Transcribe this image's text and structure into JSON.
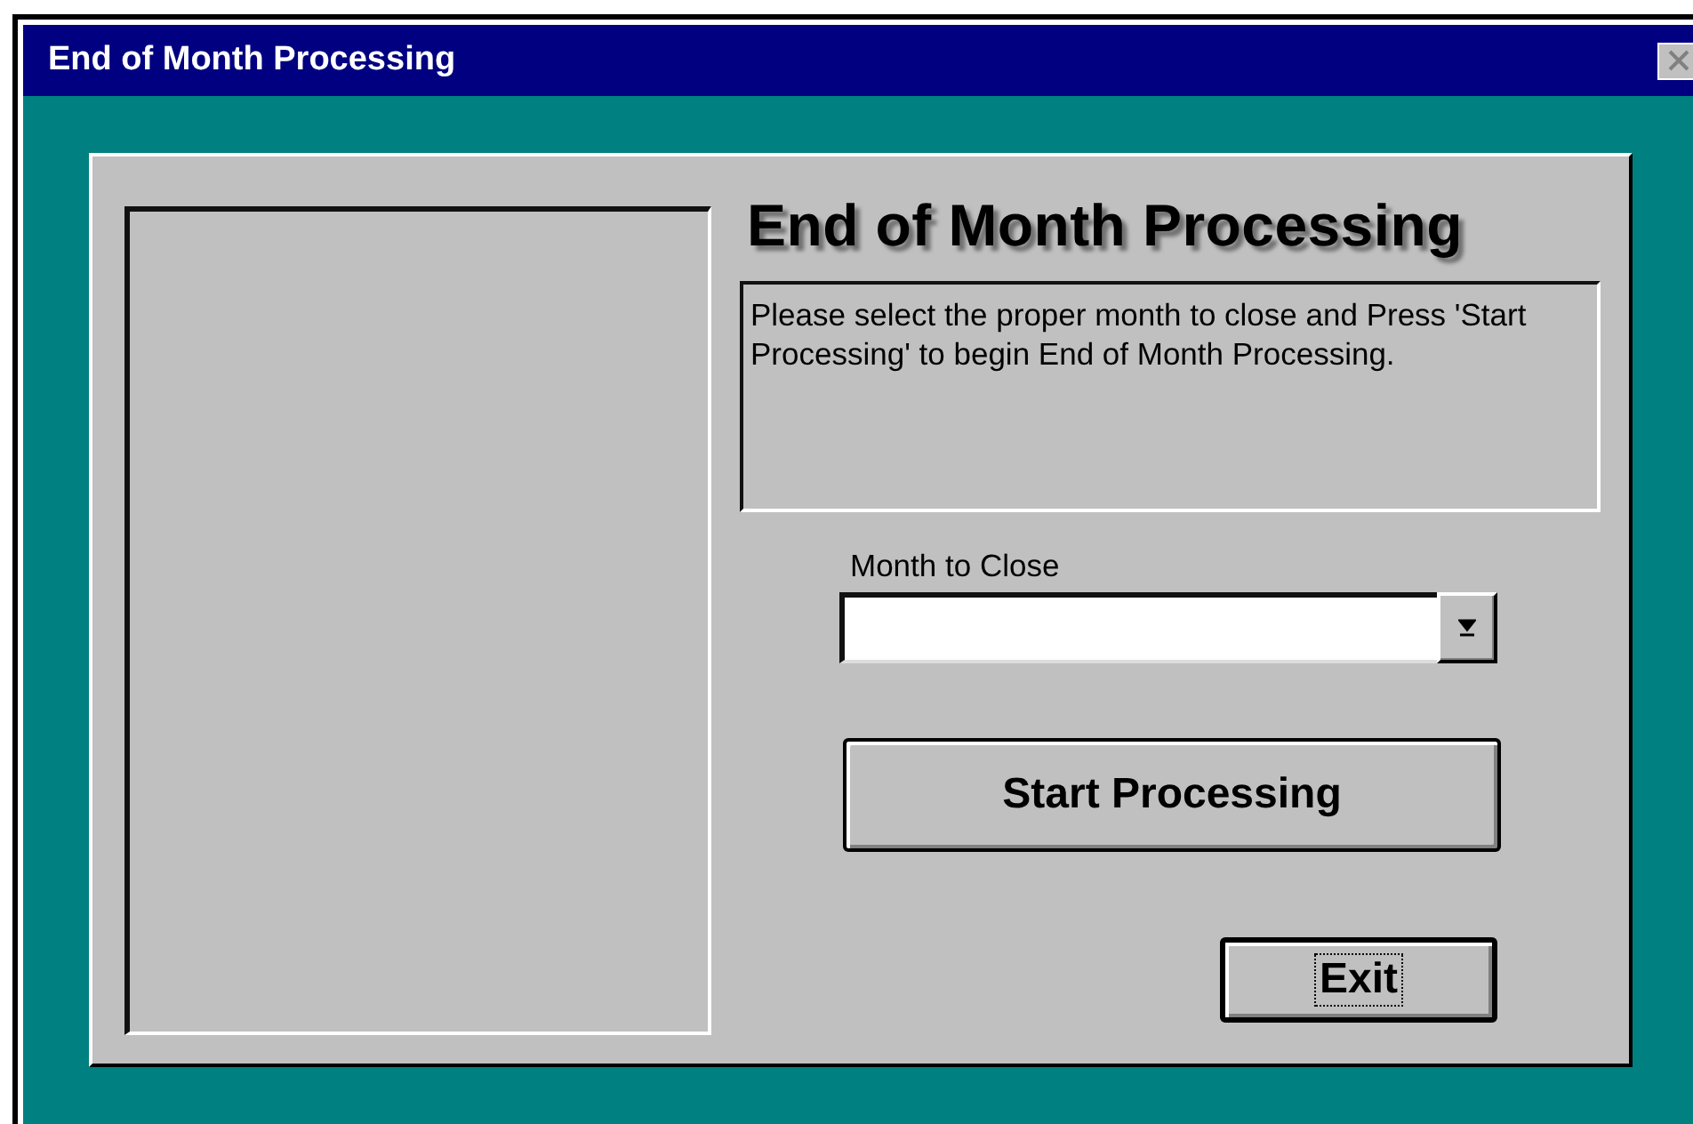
{
  "window": {
    "title": "End of Month Processing"
  },
  "heading": "End of Month Processing",
  "instructions": "Please select the proper month to close and Press 'Start Processing' to begin End of Month Processing.",
  "month_field": {
    "label": "Month to Close"
  },
  "buttons": [
    {
      "label": "Start Processing",
      "focused": false
    },
    {
      "label": "Exit",
      "focused": true
    }
  ]
}
